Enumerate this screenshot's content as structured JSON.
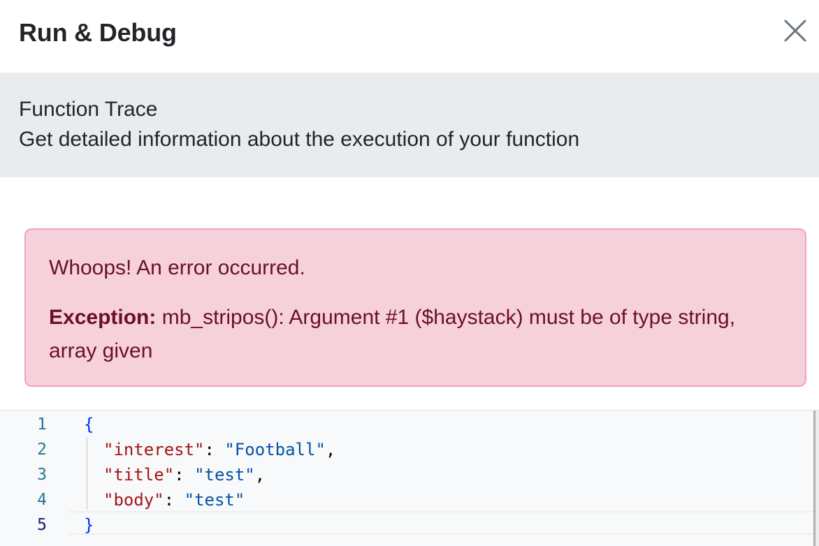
{
  "header": {
    "title": "Run & Debug",
    "close_icon": "close-icon"
  },
  "info": {
    "title": "Function Trace",
    "subtitle": "Get detailed information about the execution of your function"
  },
  "error": {
    "heading": "Whoops! An error occurred.",
    "label": "Exception:",
    "message": "mb_stripos(): Argument #1 ($haystack) must be of type string, array given"
  },
  "editor": {
    "line_numbers": [
      "1",
      "2",
      "3",
      "4",
      "5"
    ],
    "active_line": "5",
    "lines": {
      "l1_open": "{",
      "l2_key": "\"interest\"",
      "l2_colon": ": ",
      "l2_value": "\"Football\"",
      "l2_comma": ",",
      "l3_key": "\"title\"",
      "l3_colon": ": ",
      "l3_value": "\"test\"",
      "l3_comma": ",",
      "l4_key": "\"body\"",
      "l4_colon": ": ",
      "l4_value": "\"test\"",
      "l5_close": "}"
    }
  },
  "colors": {
    "alert_bg": "#f6d1dc",
    "alert_text": "#6a0f29",
    "info_bg": "#e9ecef",
    "json_key": "#a31515",
    "json_string": "#0451a5",
    "brace": "#0431fa",
    "line_number": "#237893"
  }
}
